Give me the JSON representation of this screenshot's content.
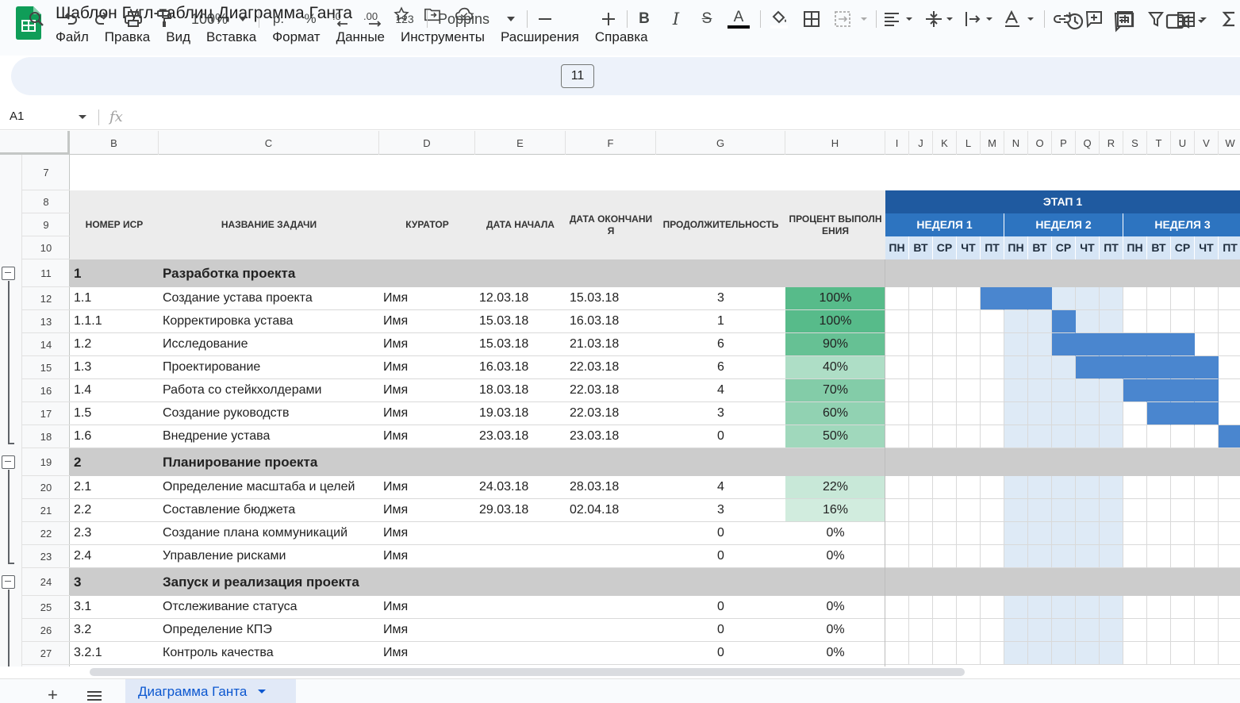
{
  "app": {
    "doc_title": "Шаблон Гугл-таблиц Диаграмма Ганта",
    "menu": [
      "Файл",
      "Правка",
      "Вид",
      "Вставка",
      "Формат",
      "Данные",
      "Инструменты",
      "Расширения",
      "Справка"
    ]
  },
  "toolbar": {
    "zoom": "100%",
    "currency": "р.",
    "percent": "%",
    "decrease_decimal": ".0",
    "increase_decimal": ".00",
    "number_format": "123",
    "font": "Poppins",
    "font_size": "11",
    "bold": "B",
    "italic": "I",
    "strike": "S",
    "text_color": "A"
  },
  "formula_bar": {
    "cell_ref": "A1",
    "fx": "fx",
    "value": ""
  },
  "columns": [
    "B",
    "C",
    "D",
    "E",
    "F",
    "G",
    "H",
    "I",
    "J",
    "K",
    "L",
    "M",
    "N",
    "O",
    "P",
    "Q",
    "R",
    "S",
    "T",
    "U",
    "V",
    "W"
  ],
  "headers": {
    "wbs": "НОМЕР ИСР",
    "task": "НАЗВАНИЕ ЗАДАЧИ",
    "owner": "КУРАТОР",
    "start": "ДАТА НАЧАЛА",
    "end": "ДАТА ОКОНЧАНИЯ",
    "duration": "ПРОДОЛЖИТЕЛЬНОСТЬ",
    "percent": "ПРОЦЕНТ ВЫПОЛНЕНИЯ",
    "phase": "ЭТАП 1",
    "weeks": [
      "НЕДЕЛЯ 1",
      "НЕДЕЛЯ 2",
      "НЕДЕЛЯ 3"
    ],
    "days": [
      "ПН",
      "ВТ",
      "СР",
      "ЧТ",
      "ПТ",
      "ПН",
      "ВТ",
      "СР",
      "ЧТ",
      "ПТ",
      "ПН",
      "ВТ",
      "СР",
      "ЧТ",
      "ПТ"
    ]
  },
  "rows": [
    {
      "num": "7",
      "type": "blank"
    },
    {
      "num": "8",
      "type": "header"
    },
    {
      "num": "9",
      "type": "header"
    },
    {
      "num": "10",
      "type": "header"
    },
    {
      "num": "11",
      "type": "section",
      "wbs": "1",
      "task": "Разработка проекта"
    },
    {
      "num": "12",
      "type": "task",
      "wbs": "1.1",
      "task": "Создание устава проекта",
      "owner": "Имя",
      "start": "12.03.18",
      "end": "15.03.18",
      "duration": "3",
      "percent": "100%",
      "progress": 1.0,
      "bar_days": [
        5,
        6,
        7
      ]
    },
    {
      "num": "13",
      "type": "task",
      "wbs": "1.1.1",
      "task": "Корректировка устава",
      "owner": "Имя",
      "start": "15.03.18",
      "end": "16.03.18",
      "duration": "1",
      "percent": "100%",
      "progress": 1.0,
      "bar_days": [
        8
      ]
    },
    {
      "num": "14",
      "type": "task",
      "wbs": "1.2",
      "task": "Исследование",
      "owner": "Имя",
      "start": "15.03.18",
      "end": "21.03.18",
      "duration": "6",
      "percent": "90%",
      "progress": 0.9,
      "bar_days": [
        8,
        9,
        10,
        11,
        12,
        13
      ]
    },
    {
      "num": "15",
      "type": "task",
      "wbs": "1.3",
      "task": "Проектирование",
      "owner": "Имя",
      "start": "16.03.18",
      "end": "22.03.18",
      "duration": "6",
      "percent": "40%",
      "progress": 0.4,
      "bar_days": [
        9,
        10,
        11,
        12,
        13,
        14
      ]
    },
    {
      "num": "16",
      "type": "task",
      "wbs": "1.4",
      "task": "Работа со стейкхолдерами",
      "owner": "Имя",
      "start": "18.03.18",
      "end": "22.03.18",
      "duration": "4",
      "percent": "70%",
      "progress": 0.7,
      "bar_days": [
        11,
        12,
        13,
        14
      ]
    },
    {
      "num": "17",
      "type": "task",
      "wbs": "1.5",
      "task": "Создание руководств",
      "owner": "Имя",
      "start": "19.03.18",
      "end": "22.03.18",
      "duration": "3",
      "percent": "60%",
      "progress": 0.6,
      "bar_days": [
        12,
        13,
        14
      ]
    },
    {
      "num": "18",
      "type": "task",
      "wbs": "1.6",
      "task": "Внедрение устава",
      "owner": "Имя",
      "start": "23.03.18",
      "end": "23.03.18",
      "duration": "0",
      "percent": "50%",
      "progress": 0.5,
      "bar_days": [
        15
      ]
    },
    {
      "num": "19",
      "type": "section",
      "wbs": "2",
      "task": "Планирование проекта"
    },
    {
      "num": "20",
      "type": "task",
      "wbs": "2.1",
      "task": "Определение масштаба и целей",
      "owner": "Имя",
      "start": "24.03.18",
      "end": "28.03.18",
      "duration": "4",
      "percent": "22%",
      "progress": 0.22,
      "bar_days": []
    },
    {
      "num": "21",
      "type": "task",
      "wbs": "2.2",
      "task": "Составление бюджета",
      "owner": "Имя",
      "start": "29.03.18",
      "end": "02.04.18",
      "duration": "3",
      "percent": "16%",
      "progress": 0.16,
      "bar_days": []
    },
    {
      "num": "22",
      "type": "task",
      "wbs": "2.3",
      "task": "Создание плана коммуникаций",
      "owner": "Имя",
      "start": "",
      "end": "",
      "duration": "0",
      "percent": "0%",
      "progress": 0,
      "bar_days": []
    },
    {
      "num": "23",
      "type": "task",
      "wbs": "2.4",
      "task": "Управление рисками",
      "owner": "Имя",
      "start": "",
      "end": "",
      "duration": "0",
      "percent": "0%",
      "progress": 0,
      "bar_days": []
    },
    {
      "num": "24",
      "type": "section",
      "wbs": "3",
      "task": "Запуск и реализация проекта"
    },
    {
      "num": "25",
      "type": "task",
      "wbs": "3.1",
      "task": "Отслеживание статуса",
      "owner": "Имя",
      "start": "",
      "end": "",
      "duration": "0",
      "percent": "0%",
      "progress": 0,
      "bar_days": []
    },
    {
      "num": "26",
      "type": "task",
      "wbs": "3.2",
      "task": "Определение КПЭ",
      "owner": "Имя",
      "start": "",
      "end": "",
      "duration": "0",
      "percent": "0%",
      "progress": 0,
      "bar_days": []
    },
    {
      "num": "27",
      "type": "task",
      "wbs": "3.2.1",
      "task": "Контроль качества",
      "owner": "Имя",
      "start": "",
      "end": "",
      "duration": "0",
      "percent": "0%",
      "progress": 0,
      "bar_days": []
    }
  ],
  "sheet_tabs": [
    {
      "label": "Диаграмма Ганта",
      "active": true
    }
  ],
  "colors": {
    "phase_bg": "#1f5aa0",
    "week_bg": "#2d74c0",
    "day_bg": "#d6e5f5",
    "bar": "#4a86cf",
    "week2_shade": "#deeaf6",
    "header_grey": "#ececec",
    "section_grey": "#cccccc",
    "progress_green": "#57bb8a"
  }
}
